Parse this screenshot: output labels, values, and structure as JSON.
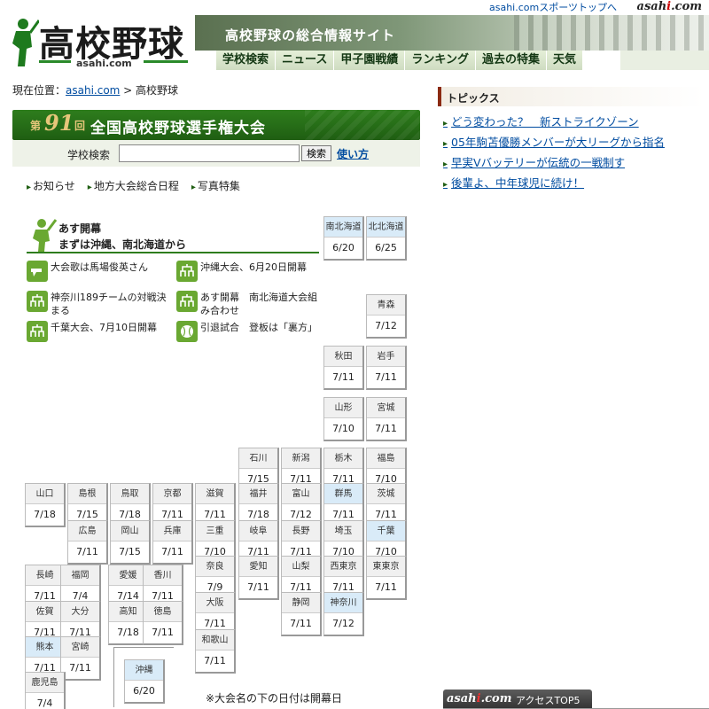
{
  "top": {
    "link": "asahi.comスポーツトップへ",
    "logo_pre": "asah",
    "logo_i": "i",
    "logo_post": ".com"
  },
  "header": {
    "logo_text": "高校野球",
    "logo_sub": "asahi.com",
    "banner_title": "高校野球の総合情報サイト",
    "nav": [
      "学校検索",
      "ニュース",
      "甲子園戦績",
      "ランキング",
      "過去の特集",
      "天気"
    ]
  },
  "breadcrumb": {
    "prefix": "現在位置：",
    "link": "asahi.com",
    "sep": " > ",
    "current": "高校野球"
  },
  "tourney": {
    "dai": "第",
    "num": "91",
    "kai": "回",
    "title": "全国高校野球選手権大会"
  },
  "search": {
    "label": "学校検索",
    "value": "",
    "button": "検索",
    "help": "使い方"
  },
  "links": [
    "お知らせ",
    "地方大会総合日程",
    "写真特集"
  ],
  "news": {
    "headline1": "あす開幕",
    "headline2": "まずは沖縄、南北海道から",
    "items": [
      {
        "text": "大会歌は馬場俊英さん",
        "icon": "megaphone-icon"
      },
      {
        "text": "沖縄大会、6月20日開幕",
        "icon": "bracket-icon"
      },
      {
        "text": "神奈川189チームの対戦決まる",
        "icon": "bracket-icon"
      },
      {
        "text": "あす開幕　南北海道大会組み合わせ",
        "icon": "bracket-icon"
      },
      {
        "text": "千葉大会、7月10日開幕",
        "icon": "bracket-icon"
      },
      {
        "text": "引退試合　登板は「裏方」",
        "icon": "baseball-icon"
      }
    ]
  },
  "prefectures": {
    "minamihokkaido": {
      "name": "南北海道",
      "date": "6/20"
    },
    "kitahokkaido": {
      "name": "北北海道",
      "date": "6/25"
    },
    "aomori": {
      "name": "青森",
      "date": "7/12"
    },
    "akita": {
      "name": "秋田",
      "date": "7/11"
    },
    "iwate": {
      "name": "岩手",
      "date": "7/11"
    },
    "yamagata": {
      "name": "山形",
      "date": "7/10"
    },
    "miyagi": {
      "name": "宮城",
      "date": "7/11"
    },
    "ishikawa": {
      "name": "石川",
      "date": "7/15"
    },
    "niigata": {
      "name": "新潟",
      "date": "7/11"
    },
    "tochigi": {
      "name": "栃木",
      "date": "7/11"
    },
    "fukushima": {
      "name": "福島",
      "date": "7/10"
    },
    "yamaguchi": {
      "name": "山口",
      "date": "7/18"
    },
    "shimane": {
      "name": "島根",
      "date": "7/15"
    },
    "tottori": {
      "name": "鳥取",
      "date": "7/18"
    },
    "kyoto": {
      "name": "京都",
      "date": "7/11"
    },
    "shiga": {
      "name": "滋賀",
      "date": "7/11"
    },
    "fukui": {
      "name": "福井",
      "date": "7/18"
    },
    "toyama": {
      "name": "富山",
      "date": "7/12"
    },
    "gunma": {
      "name": "群馬",
      "date": "7/11"
    },
    "ibaraki": {
      "name": "茨城",
      "date": "7/11"
    },
    "hiroshima": {
      "name": "広島",
      "date": "7/11"
    },
    "okayama": {
      "name": "岡山",
      "date": "7/15"
    },
    "hyogo": {
      "name": "兵庫",
      "date": "7/11"
    },
    "mie": {
      "name": "三重",
      "date": "7/10"
    },
    "gifu": {
      "name": "岐阜",
      "date": "7/11"
    },
    "nagano": {
      "name": "長野",
      "date": "7/11"
    },
    "saitama": {
      "name": "埼玉",
      "date": "7/10"
    },
    "chiba": {
      "name": "千葉",
      "date": "7/10"
    },
    "nagasaki": {
      "name": "長崎",
      "date": "7/11"
    },
    "fukuoka": {
      "name": "福岡",
      "date": "7/4"
    },
    "ehime": {
      "name": "愛媛",
      "date": "7/14"
    },
    "kagawa": {
      "name": "香川",
      "date": "7/11"
    },
    "nara": {
      "name": "奈良",
      "date": "7/9"
    },
    "aichi": {
      "name": "愛知",
      "date": "7/11"
    },
    "yamanashi": {
      "name": "山梨",
      "date": "7/11"
    },
    "nishitokyo": {
      "name": "西東京",
      "date": "7/11"
    },
    "higashitokyo": {
      "name": "東東京",
      "date": "7/11"
    },
    "saga": {
      "name": "佐賀",
      "date": "7/11"
    },
    "oita": {
      "name": "大分",
      "date": "7/11"
    },
    "kochi": {
      "name": "高知",
      "date": "7/18"
    },
    "tokushima": {
      "name": "徳島",
      "date": "7/11"
    },
    "osaka": {
      "name": "大阪",
      "date": "7/11"
    },
    "shizuoka": {
      "name": "静岡",
      "date": "7/11"
    },
    "kanagawa": {
      "name": "神奈川",
      "date": "7/12"
    },
    "kumamoto": {
      "name": "熊本",
      "date": "7/11"
    },
    "miyazaki": {
      "name": "宮崎",
      "date": "7/11"
    },
    "wakayama": {
      "name": "和歌山",
      "date": "7/11"
    },
    "okinawa": {
      "name": "沖縄",
      "date": "6/20"
    },
    "kagoshima": {
      "name": "鹿児島",
      "date": "7/4"
    }
  },
  "note": "※大会名の下の日付は開幕日",
  "topics": {
    "title": "トピックス",
    "items": [
      "どう変わった？　新ストライクゾーン",
      "05年駒苫優勝メンバーが大リーグから指名",
      "早実Vバッテリーが伝統の一戦制す",
      "後輩よ、中年球児に続け！"
    ]
  },
  "access": {
    "logo_pre": "asah",
    "logo_i": "i",
    "logo_post": ".com",
    "label": "アクセスTOP5"
  },
  "colors": {
    "accent_green": "#2e7d1d",
    "link_blue": "#004ca0",
    "highlight_blue": "#d9ebf8"
  }
}
